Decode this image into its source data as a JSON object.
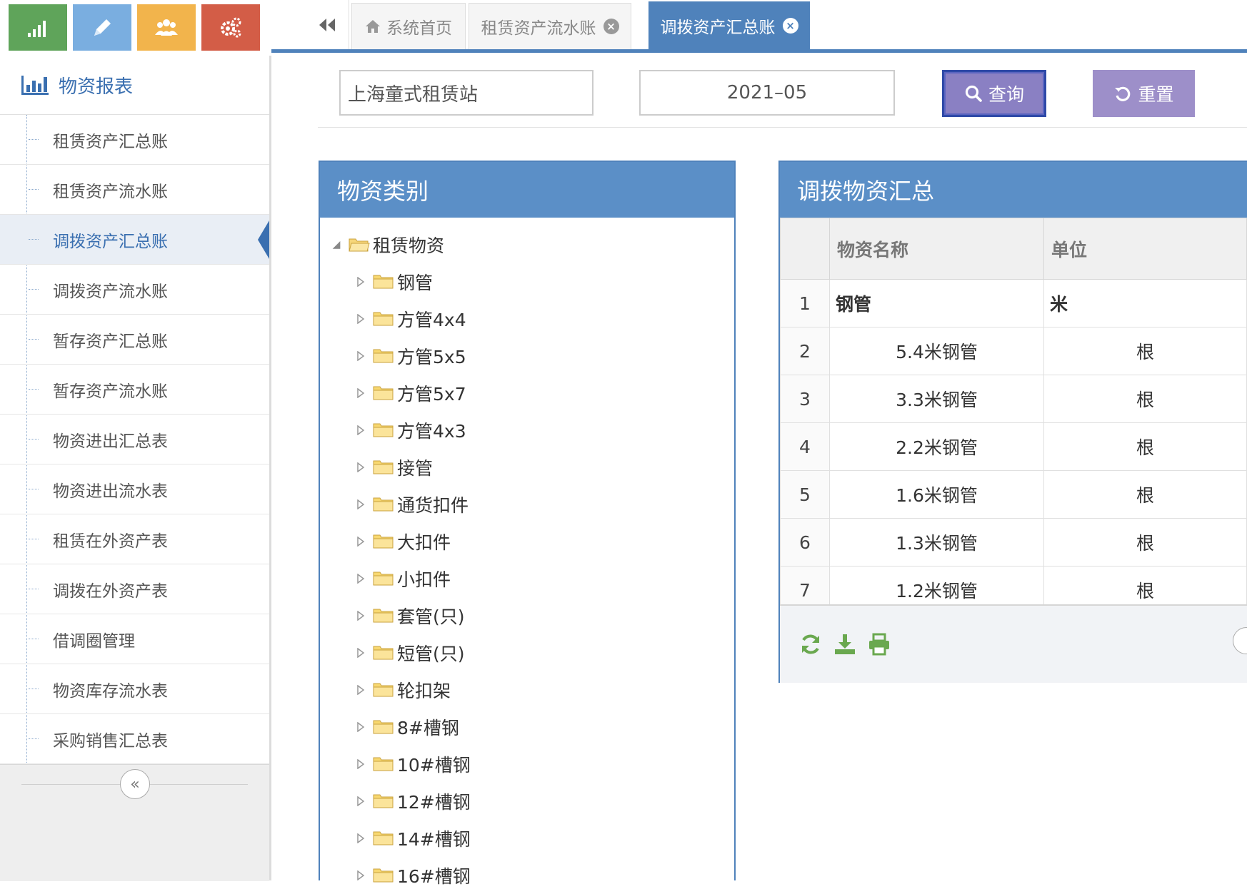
{
  "sidebar": {
    "quick_buttons": [
      {
        "name": "chart-icon",
        "color": "#5fa45a"
      },
      {
        "name": "pencil-icon",
        "color": "#7aaee0"
      },
      {
        "name": "users-icon",
        "color": "#f2b44c"
      },
      {
        "name": "gears-icon",
        "color": "#d35d47"
      }
    ],
    "module_title": "物资报表",
    "items": [
      {
        "label": "租赁资产汇总账"
      },
      {
        "label": "租赁资产流水账"
      },
      {
        "label": "调拨资产汇总账"
      },
      {
        "label": "调拨资产流水账"
      },
      {
        "label": "暂存资产汇总账"
      },
      {
        "label": "暂存资产流水账"
      },
      {
        "label": "物资进出汇总表"
      },
      {
        "label": "物资进出流水表"
      },
      {
        "label": "租赁在外资产表"
      },
      {
        "label": "调拨在外资产表"
      },
      {
        "label": "借调圈管理"
      },
      {
        "label": "物资库存流水表"
      },
      {
        "label": "采购销售汇总表"
      }
    ],
    "active_index": 2,
    "collapse_glyph": "«"
  },
  "tabs": {
    "back_glyph": "◀◀",
    "items": [
      {
        "label": "系统首页",
        "closable": false,
        "home": true
      },
      {
        "label": "租赁资产流水账",
        "closable": true
      },
      {
        "label": "调拨资产汇总账",
        "closable": true,
        "active": true
      }
    ],
    "close_glyph": "×"
  },
  "filter": {
    "station": "上海童式租赁站",
    "month": "2021–05",
    "query_label": "查询",
    "reset_label": "重置"
  },
  "category_panel": {
    "title": "物资类别",
    "root": "租赁物资",
    "children": [
      "钢管",
      "方管4x4",
      "方管5x5",
      "方管5x7",
      "方管4x3",
      "接管",
      "通货扣件",
      "大扣件",
      "小扣件",
      "套管(只)",
      "短管(只)",
      "轮扣架",
      "8#槽钢",
      "10#槽钢",
      "12#槽钢",
      "14#槽钢",
      "16#槽钢"
    ]
  },
  "summary_panel": {
    "title": "调拨物资汇总",
    "columns": [
      "物资名称",
      "单位"
    ],
    "rows": [
      {
        "no": "1",
        "name": "钢管",
        "unit": "米",
        "group": true
      },
      {
        "no": "2",
        "name": "5.4米钢管",
        "unit": "根"
      },
      {
        "no": "3",
        "name": "3.3米钢管",
        "unit": "根"
      },
      {
        "no": "4",
        "name": "2.2米钢管",
        "unit": "根"
      },
      {
        "no": "5",
        "name": "1.6米钢管",
        "unit": "根"
      },
      {
        "no": "6",
        "name": "1.3米钢管",
        "unit": "根"
      },
      {
        "no": "7",
        "name": "1.2米钢管",
        "unit": "根"
      }
    ],
    "toolbar": [
      "refresh-icon",
      "download-icon",
      "print-icon"
    ]
  },
  "colors": {
    "accent": "#4f82bb",
    "panel_header": "#5b8fc7",
    "toolbar_icon": "#6aa84f",
    "query_button": "#8a80c3",
    "reset_button": "#9d8fc9"
  }
}
